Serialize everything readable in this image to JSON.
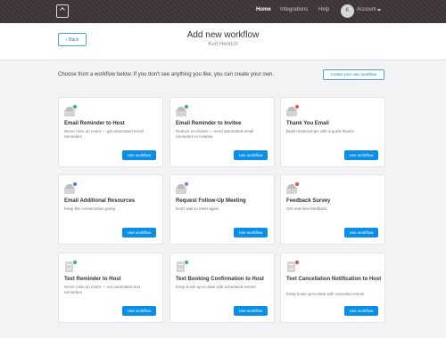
{
  "topbar": {
    "nav": [
      "Home",
      "Integrations",
      "Help"
    ],
    "avatar_initial": "K",
    "account_label": "Account"
  },
  "header": {
    "back_label": "Back",
    "title": "Add new workflow",
    "subtitle": "Kurt Henrich"
  },
  "intro": {
    "text": "Choose from a workflow below. If you don't see anything you like, you can create your own.",
    "create_label": "Create your own workflow"
  },
  "cards": [
    {
      "title": "Email Reminder to Host",
      "desc": "Never miss an event — get automated email reminders",
      "button": "Use workflow",
      "icon": "email-icon",
      "badge_color": "#2db86f"
    },
    {
      "title": "Email Reminder to Invitee",
      "desc": "Reduce no-shows — send automated email reminders to invitees",
      "button": "Use workflow",
      "icon": "email-icon",
      "badge_color": "#2db86f"
    },
    {
      "title": "Thank You Email",
      "desc": "Build relationships with a quick thanks",
      "button": "Use workflow",
      "icon": "email-icon",
      "badge_color": "#e0533f"
    },
    {
      "title": "Email Additional Resources",
      "desc": "Keep the conversation going",
      "button": "Use workflow",
      "icon": "email-icon",
      "badge_color": "#4a7fe0"
    },
    {
      "title": "Request Follow-Up Meeting",
      "desc": "Don't wait to meet again",
      "button": "Use workflow",
      "icon": "email-icon",
      "badge_color": "#9b6fe0"
    },
    {
      "title": "Feedback Survey",
      "desc": "Get real-time feedback",
      "button": "Use workflow",
      "icon": "email-icon",
      "badge_color": "#e0533f"
    },
    {
      "title": "Text Reminder to Host",
      "desc": "Never miss an event — set automated text reminders",
      "button": "Use workflow",
      "icon": "text-doc-icon",
      "badge_color": "#2db86f"
    },
    {
      "title": "Text Booking Confirmation to Host",
      "desc": "Keep hosts up-to-date with scheduled events",
      "button": "Use workflow",
      "icon": "text-doc-icon",
      "badge_color": "#2db86f"
    },
    {
      "title": "Text Cancellation Notification to Host",
      "desc": "Keep hosts up-to-date with canceled events",
      "button": "Use workflow",
      "icon": "text-doc-icon",
      "badge_color": "#e0533f"
    }
  ],
  "colors": {
    "primary": "#0a8fe6",
    "topbar": "#3b3336"
  }
}
